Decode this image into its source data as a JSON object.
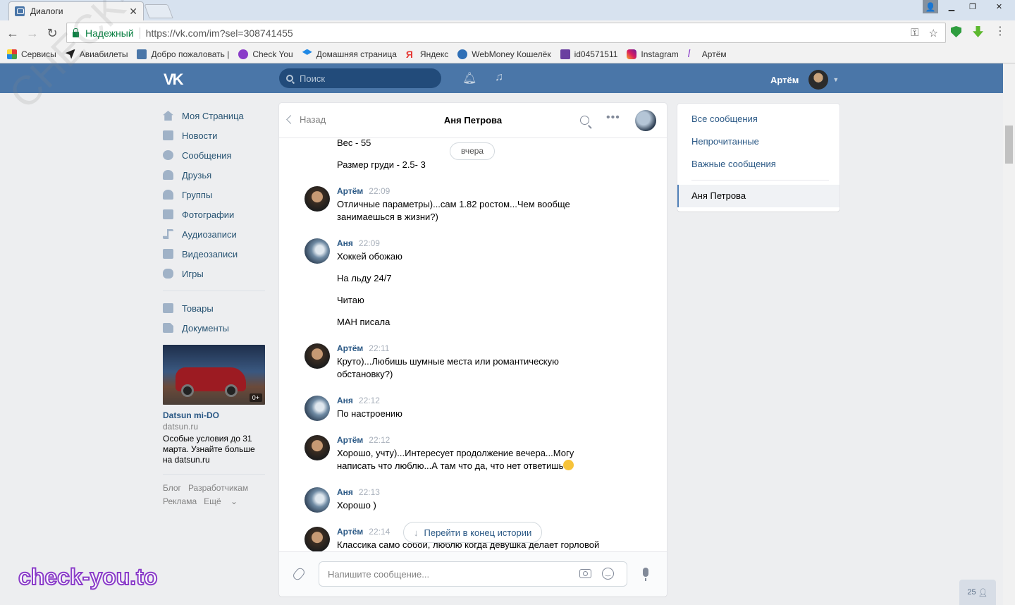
{
  "browser": {
    "tab_title": "Диалоги",
    "tab_close": "✕",
    "secure_label": "Надежный",
    "url": "https://vk.com/im?sel=308741455",
    "bookmarks": [
      "Сервисы",
      "Авиабилеты",
      "Добро пожаловать |",
      "Check You",
      "Домашняя страница",
      "Яндекс",
      "WebMoney Кошелёк",
      "id04571511",
      "Instagram",
      "Артём"
    ]
  },
  "vk_header": {
    "logo": "VK",
    "search_placeholder": "Поиск",
    "user_name": "Артём"
  },
  "left_nav": {
    "items": [
      "Моя Страница",
      "Новости",
      "Сообщения",
      "Друзья",
      "Группы",
      "Фотографии",
      "Аудиозаписи",
      "Видеозаписи",
      "Игры"
    ],
    "items2": [
      "Товары",
      "Документы"
    ],
    "ad": {
      "badge": "0+",
      "title": "Datsun mi-DO",
      "domain": "datsun.ru",
      "text_lines": [
        "Особые условия до 31",
        "марта. Узнайте больше",
        "на datsun.ru"
      ]
    },
    "footer": [
      "Блог",
      "Разработчикам",
      "Реклама",
      "Ещё"
    ]
  },
  "chat": {
    "back_label": "Назад",
    "name": "Аня Петрова",
    "date_pill": "вчера",
    "loose_lines": [
      "Вес - 55",
      "Размер груди - 2.5- 3"
    ],
    "messages": [
      {
        "author": "Артём",
        "time": "22:09",
        "lines": [
          "Отличные параметры)...сам 1.82 ростом...Чем вообще",
          "занимаешься в жизни?)"
        ]
      },
      {
        "author": "Аня",
        "time": "22:09",
        "lines": [
          "Хоккей обожаю"
        ]
      },
      {
        "author": "Артём",
        "time": "22:11",
        "lines": [
          "Круто)...Любишь шумные места или романтическую",
          "обстановку?)"
        ]
      },
      {
        "author": "Аня",
        "time": "22:12",
        "lines": [
          "По настроению"
        ]
      },
      {
        "author": "Артём",
        "time": "22:12",
        "lines": [
          "Хорошо, учту)...Интересует продолжение вечера...Могу",
          "написать что люблю...А там что да, что нет ответишь"
        ]
      },
      {
        "author": "Аня",
        "time": "22:13",
        "lines": [
          "Хорошо )"
        ]
      },
      {
        "author": "Артём",
        "time": "22:14",
        "lines": [
          "Классика само собой, люблю когда девушка делает горловой"
        ]
      }
    ],
    "extra_lines": [
      "На льду 24/7",
      "Читаю",
      "МАН писала"
    ],
    "jump_label": "Перейти в конец истории",
    "composer_placeholder": "Напишите сообщение..."
  },
  "right_menu": {
    "items": [
      "Все сообщения",
      "Непрочитанные",
      "Важные сообщения"
    ],
    "active": "Аня Петрова"
  },
  "counter": "25",
  "watermark": "check-you.to",
  "watermark_diag": "CHECK-YOU.ME"
}
